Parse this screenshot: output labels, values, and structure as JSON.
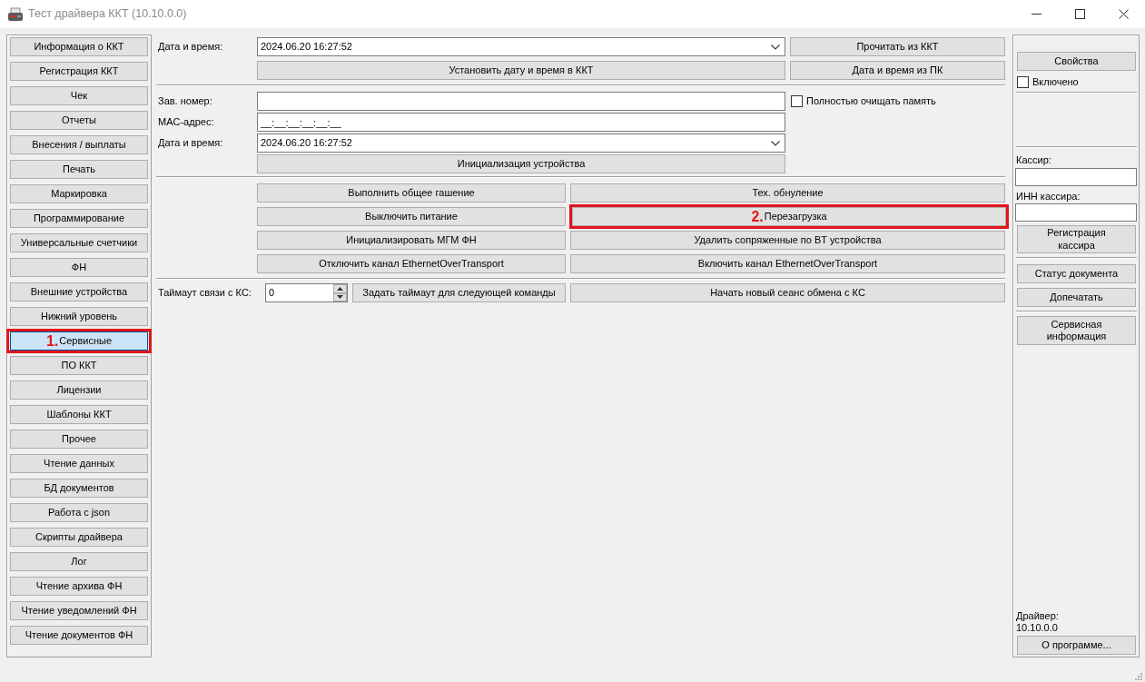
{
  "window": {
    "title": "Тест драйвера ККТ (10.10.0.0)"
  },
  "sidebar": {
    "items": [
      {
        "label": "Информация о ККТ",
        "selected": false
      },
      {
        "label": "Регистрация ККТ",
        "selected": false
      },
      {
        "label": "Чек",
        "selected": false
      },
      {
        "label": "Отчеты",
        "selected": false
      },
      {
        "label": "Внесения / выплаты",
        "selected": false
      },
      {
        "label": "Печать",
        "selected": false
      },
      {
        "label": "Маркировка",
        "selected": false
      },
      {
        "label": "Программирование",
        "selected": false
      },
      {
        "label": "Универсальные счетчики",
        "selected": false
      },
      {
        "label": "ФН",
        "selected": false
      },
      {
        "label": "Внешние устройства",
        "selected": false
      },
      {
        "label": "Нижний уровень",
        "selected": false
      },
      {
        "label": "Сервисные",
        "selected": true,
        "callout": "1."
      },
      {
        "label": "ПО ККТ",
        "selected": false
      },
      {
        "label": "Лицензии",
        "selected": false
      },
      {
        "label": "Шаблоны ККТ",
        "selected": false
      },
      {
        "label": "Прочее",
        "selected": false
      },
      {
        "label": "Чтение данных",
        "selected": false
      },
      {
        "label": "БД документов",
        "selected": false
      },
      {
        "label": "Работа с json",
        "selected": false
      },
      {
        "label": "Скрипты драйвера",
        "selected": false
      },
      {
        "label": "Лог",
        "selected": false
      },
      {
        "label": "Чтение архива ФН",
        "selected": false
      },
      {
        "label": "Чтение уведомлений ФН",
        "selected": false
      },
      {
        "label": "Чтение документов ФН",
        "selected": false
      }
    ]
  },
  "date_time": {
    "label": "Дата и время:",
    "value": "2024.06.20 16:27:52",
    "read_button": "Прочитать из ККТ",
    "set_button": "Установить дату и время в ККТ",
    "from_pc_button": "Дата и время из ПК"
  },
  "initialization": {
    "serial_number": {
      "label": "Зав. номер:"
    },
    "clear_memory": {
      "label": "Полностью очищать память",
      "checked": false
    },
    "mac_address": {
      "label": "MAC-адрес:",
      "value": "__:__:__:__:__:__"
    },
    "date_time": {
      "label": "Дата и время:",
      "value": "2024.06.20 16:27:52"
    },
    "init_button": "Инициализация устройства"
  },
  "service_buttons": [
    {
      "label": "Выполнить общее гашение"
    },
    {
      "label": "Тех. обнуление"
    },
    {
      "label": "Выключить питание"
    },
    {
      "label": "Перезагрузка",
      "callout": "2."
    },
    {
      "label": "Инициализировать МГМ ФН"
    },
    {
      "label": "Удалить сопряженные по BT устройства"
    },
    {
      "label": "Отключить канал EthernetOverTransport"
    },
    {
      "label": "Включить канал EthernetOverTransport"
    }
  ],
  "timeout": {
    "label": "Таймаут связи с КС:",
    "value": "0",
    "set_button": "Задать таймаут для следующей команды",
    "new_session_button": "Начать новый сеанс обмена с КС"
  },
  "right_panel": {
    "properties_button": "Свойства",
    "enabled": {
      "label": "Включено",
      "checked": false
    },
    "cashier": {
      "label": "Кассир:"
    },
    "cashier_inn": {
      "label": "ИНН кассира:"
    },
    "register_cashier_button": "Регистрация кассира",
    "document_status_button": "Статус документа",
    "reprint_button": "Допечатать",
    "service_info_button": "Сервисная информация",
    "driver_label": "Драйвер:",
    "driver_version": "10.10.0.0",
    "about_button": "О программе..."
  }
}
